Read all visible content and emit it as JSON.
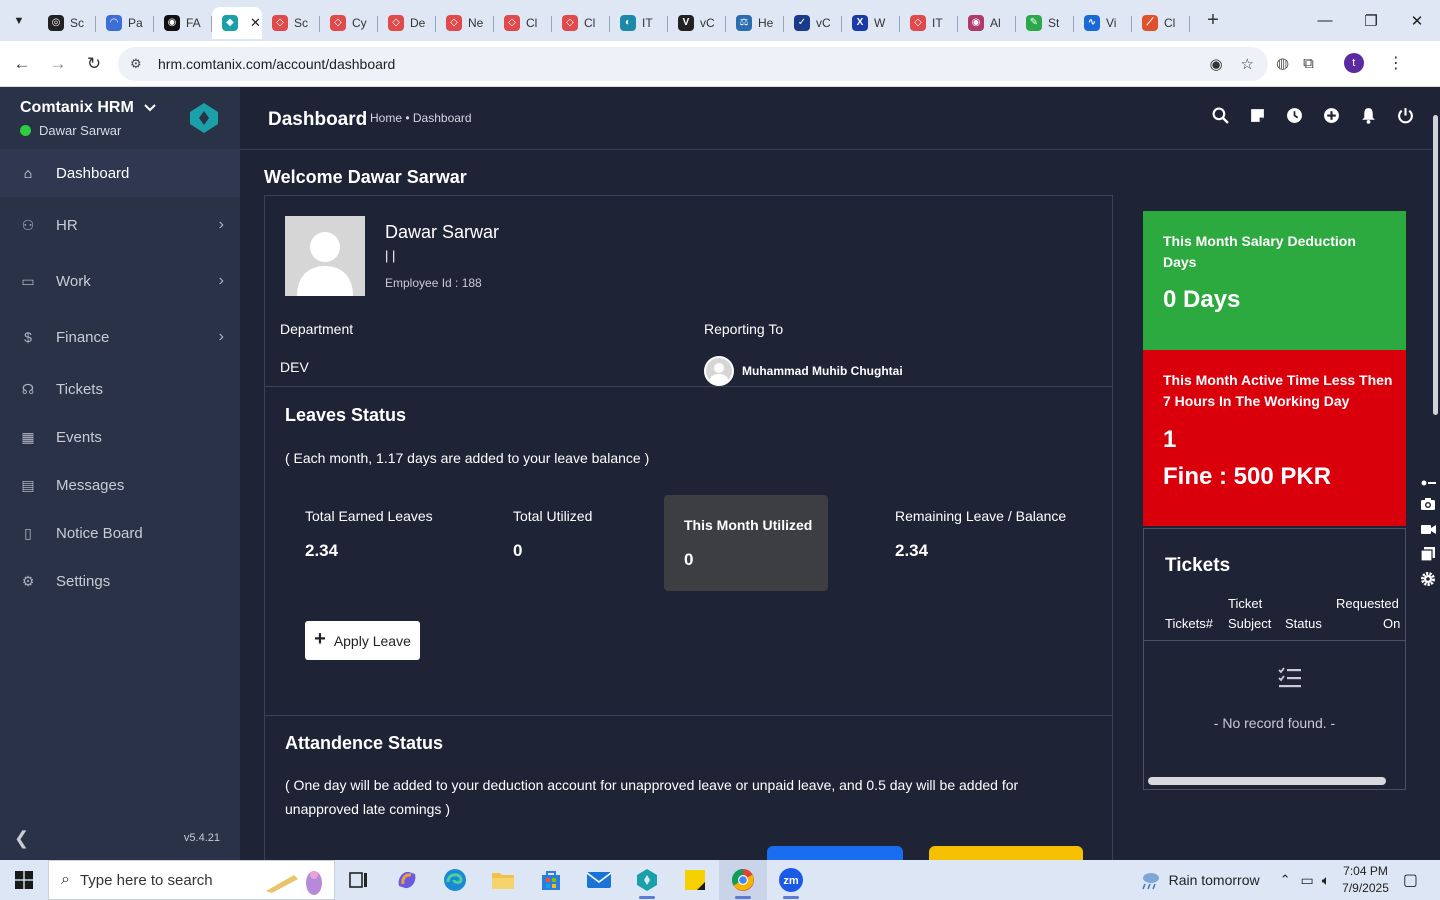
{
  "browser": {
    "tabs": [
      {
        "label": "Sc",
        "color": "#222222",
        "glyph": "◎"
      },
      {
        "label": "Pa",
        "color": "#3b6fd6",
        "glyph": "◠"
      },
      {
        "label": "FA",
        "color": "#111111",
        "glyph": "◉"
      },
      {
        "label": "",
        "color": "#1aa0a8",
        "glyph": "◆",
        "active": true
      },
      {
        "label": "Sc",
        "color": "#e04a4a",
        "glyph": "◇"
      },
      {
        "label": "Cy",
        "color": "#e04a4a",
        "glyph": "◇"
      },
      {
        "label": "De",
        "color": "#e04a4a",
        "glyph": "◇"
      },
      {
        "label": "Ne",
        "color": "#e04a4a",
        "glyph": "◇"
      },
      {
        "label": "Cl",
        "color": "#e04a4a",
        "glyph": "◇"
      },
      {
        "label": "Cl",
        "color": "#e04a4a",
        "glyph": "◇"
      },
      {
        "label": "IT",
        "color": "#1a8aa8",
        "glyph": "◐"
      },
      {
        "label": "vC",
        "color": "#222222",
        "glyph": "V"
      },
      {
        "label": "He",
        "color": "#2a6db0",
        "glyph": "⚖"
      },
      {
        "label": "vC",
        "color": "#1a3a8a",
        "glyph": "✓"
      },
      {
        "label": "W",
        "color": "#1a3aa8",
        "glyph": "X"
      },
      {
        "label": "IT",
        "color": "#e04a4a",
        "glyph": "◇"
      },
      {
        "label": "Al",
        "color": "#b03a6a",
        "glyph": "◉"
      },
      {
        "label": "St",
        "color": "#2aa84a",
        "glyph": "✎"
      },
      {
        "label": "Vi",
        "color": "#1a6ad6",
        "glyph": "∿"
      },
      {
        "label": "Cl",
        "color": "#e0502a",
        "glyph": "⟋"
      }
    ],
    "url": "hrm.comtanix.com/account/dashboard"
  },
  "sidebar": {
    "brand": "Comtanix HRM",
    "user": "Dawar Sarwar",
    "items": [
      {
        "label": "Dashboard",
        "icon": "home-icon",
        "glyph": "⌂",
        "active": true,
        "chevron": false
      },
      {
        "label": "HR",
        "icon": "users-icon",
        "glyph": "⚇",
        "chevron": true
      },
      {
        "label": "Work",
        "icon": "briefcase-icon",
        "glyph": "▭",
        "chevron": true
      },
      {
        "label": "Finance",
        "icon": "dollar-icon",
        "glyph": "$",
        "chevron": true
      },
      {
        "label": "Tickets",
        "icon": "headset-icon",
        "glyph": "☊",
        "chevron": false
      },
      {
        "label": "Events",
        "icon": "calendar-icon",
        "glyph": "▦",
        "chevron": false
      },
      {
        "label": "Messages",
        "icon": "message-icon",
        "glyph": "▤",
        "chevron": false
      },
      {
        "label": "Notice Board",
        "icon": "clipboard-icon",
        "glyph": "▯",
        "chevron": false
      },
      {
        "label": "Settings",
        "icon": "gear-icon",
        "glyph": "⚙",
        "chevron": false
      }
    ],
    "version": "v5.4.21"
  },
  "header": {
    "title": "Dashboard",
    "breadcrumb": "Home • Dashboard"
  },
  "welcome": "Welcome Dawar Sarwar",
  "profile": {
    "name": "Dawar Sarwar",
    "separator": "| |",
    "employee_id": "Employee Id : 188",
    "department_label": "Department",
    "department": "DEV",
    "reporting_label": "Reporting To",
    "reporting_to": "Muhammad Muhib Chughtai"
  },
  "leaves": {
    "title": "Leaves Status",
    "note": "( Each month, 1.17 days are added to your leave balance )",
    "earned_label": "Total Earned Leaves",
    "earned": "2.34",
    "utilized_label": "Total Utilized",
    "utilized": "0",
    "month_label": "This Month Utilized",
    "month": "0",
    "remaining_label": "Remaining Leave / Balance",
    "remaining": "2.34",
    "apply_button": "Apply Leave"
  },
  "attendance": {
    "title": "Attandence Status",
    "note": "( One day will be added to your deduction account for unapproved leave or unpaid leave, and 0.5 day will be added for unapproved late comings )"
  },
  "cards": {
    "salary_title": "This Month Salary Deduction Days",
    "salary_value": "0 Days",
    "active_title": "This Month Active Time Less Then 7 Hours In The Working Day",
    "active_count": "1",
    "active_fine": "Fine : 500 PKR"
  },
  "tickets": {
    "title": "Tickets",
    "col_number": "Tickets#",
    "col_subject_1": "Ticket",
    "col_subject_2": "Subject",
    "col_status": "Status",
    "col_requested_1": "Requested",
    "col_requested_2": "On",
    "empty": "- No record found. -"
  },
  "taskbar": {
    "search_placeholder": "Type here to search",
    "weather": "Rain tomorrow",
    "time": "7:04 PM",
    "date": "7/9/2025"
  },
  "colors": {
    "green": "#2daa3f",
    "red": "#d9000c",
    "sidebar": "#2a3248",
    "background": "#1e2336"
  }
}
